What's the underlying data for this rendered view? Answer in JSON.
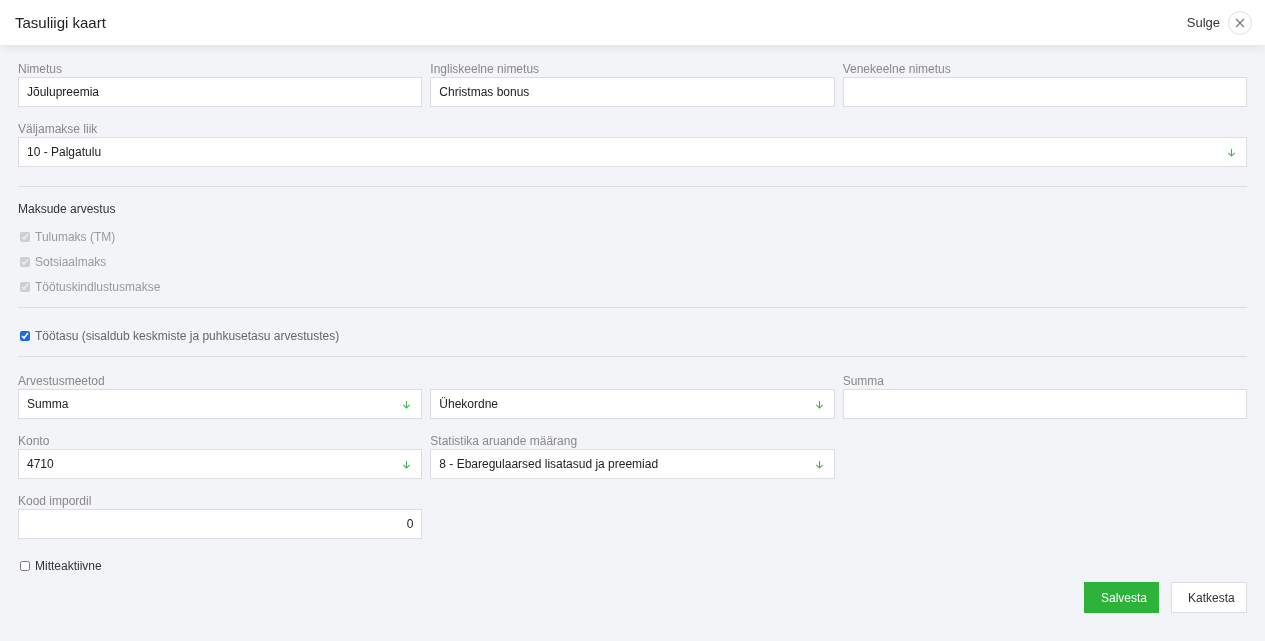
{
  "header": {
    "title": "Tasuliigi kaart",
    "close_label": "Sulge"
  },
  "name_fields": [
    {
      "kind": "text",
      "label": "Nimetus",
      "value": "Jõulupreemia"
    },
    {
      "kind": "text",
      "label": "Ingliskeelne nimetus",
      "value": "Christmas bonus"
    },
    {
      "kind": "text",
      "label": "Venekeelne nimetus"
    }
  ],
  "payout_type": {
    "kind": "select",
    "label": "Väljamakse liik",
    "value": "10 - Palgatulu"
  },
  "taxes": {
    "title": "Maksude arvestus",
    "items": [
      {
        "label": "Tulumaks (TM)",
        "checked": true,
        "disabled": true
      },
      {
        "label": "Sotsiaalmaks",
        "checked": true,
        "disabled": true
      },
      {
        "label": "Töötuskindlustusmakse",
        "checked": true,
        "disabled": true
      }
    ]
  },
  "salary": {
    "label": "Töötasu (sisaldub keskmiste ja puhkusetasu arvestustes)",
    "checked": true,
    "disabled": false
  },
  "calc_fields": [
    {
      "kind": "select",
      "label": "Arvestusmeetod",
      "value": "Summa"
    },
    {
      "kind": "select",
      "value": "Ühekordne"
    },
    {
      "kind": "text",
      "label": "Summa"
    },
    {
      "kind": "select",
      "label": "Konto",
      "value": "4710"
    },
    {
      "kind": "select",
      "label": "Statistika aruande määrang",
      "value": "8 - Ebaregulaarsed lisatasud ja preemiad"
    },
    {
      "kind": "empty"
    },
    {
      "kind": "number",
      "label": "Kood impordil",
      "value": "0"
    }
  ],
  "inactive": {
    "label": "Mitteaktiivne",
    "checked": false,
    "disabled": false
  },
  "buttons": [
    {
      "kind": "primary",
      "label": "Salvesta"
    },
    {
      "kind": "secondary",
      "label": "Katkesta"
    }
  ]
}
